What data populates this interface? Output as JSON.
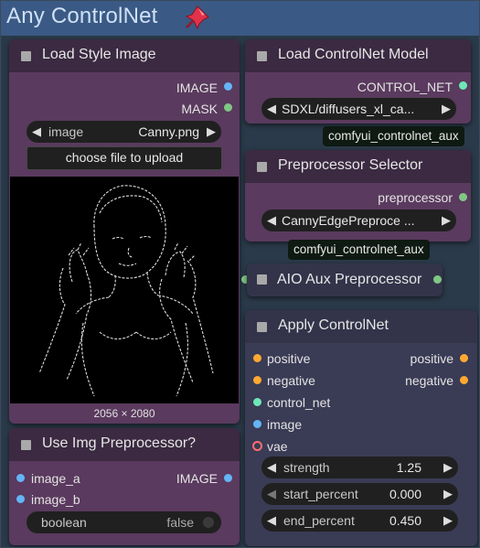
{
  "group": {
    "title": "Any ControlNet"
  },
  "load_style_image": {
    "title": "Load Style Image",
    "outputs": [
      "IMAGE",
      "MASK"
    ],
    "image_widget": {
      "name": "image",
      "value": "Canny.png"
    },
    "upload_label": "choose file to upload",
    "image_size": "2056 × 2080"
  },
  "use_img_preprocessor": {
    "title": "Use Img Preprocessor?",
    "inputs": [
      "image_a",
      "image_b"
    ],
    "output": "IMAGE",
    "toggle": {
      "name": "boolean",
      "value": "false"
    }
  },
  "load_controlnet_model": {
    "title": "Load ControlNet Model",
    "output": "CONTROL_NET",
    "model_value": "SDXL/diffusers_xl_ca...",
    "badge": "comfyui_controlnet_aux"
  },
  "preprocessor_selector": {
    "title": "Preprocessor Selector",
    "output": "preprocessor",
    "value": "CannyEdgePreproce ...",
    "badge": "comfyui_controlnet_aux"
  },
  "aio_aux": {
    "title": "AIO Aux Preprocessor"
  },
  "apply_controlnet": {
    "title": "Apply ControlNet",
    "inputs": [
      "positive",
      "negative",
      "control_net",
      "image",
      "vae"
    ],
    "outputs": [
      "positive",
      "negative"
    ],
    "widgets": [
      {
        "name": "strength",
        "value": "1.25"
      },
      {
        "name": "start_percent",
        "value": "0.000"
      },
      {
        "name": "end_percent",
        "value": "0.450"
      }
    ]
  },
  "colors": {
    "group_bg": "#2b3a4a",
    "group_title": "#3a5a85",
    "purple_node": "#5a3a5e",
    "blue_node": "#3a3b55",
    "image_port": "#64b5f6",
    "mask_port": "#81c784",
    "conditioning_port": "#ffa931",
    "control_net_port": "#6ee7b7",
    "vae_port": "#ff6e6e"
  }
}
